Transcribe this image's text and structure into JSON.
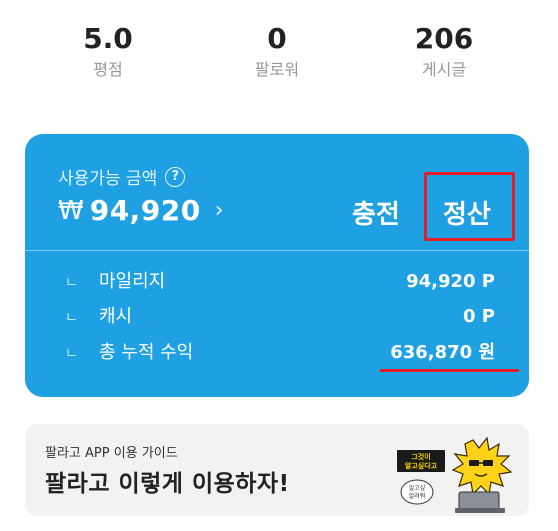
{
  "stats": [
    {
      "value": "5.0",
      "label": "평점"
    },
    {
      "value": "0",
      "label": "팔로워"
    },
    {
      "value": "206",
      "label": "게시글"
    }
  ],
  "wallet": {
    "available_label": "사용가능 금액",
    "help_icon": "question-circle-icon",
    "currency_symbol": "₩",
    "balance": "94,920",
    "chevron_icon": "chevron-right-icon",
    "charge_label": "충전",
    "settle_label": "정산",
    "rows": [
      {
        "bullet": "ㄴ",
        "name": "마일리지",
        "value": "94,920 P"
      },
      {
        "bullet": "ㄴ",
        "name": "캐시",
        "value": "0 P"
      },
      {
        "bullet": "ㄴ",
        "name": "총 누적 수익",
        "value": "636,870 원"
      }
    ],
    "card_color": "#1fa0e2",
    "highlight_color": "#e31b24"
  },
  "banner": {
    "subtitle": "팔라고 APP 이용 가이드",
    "title": "팔라고 이렇게 이용하자!",
    "mascot_caption": "그것이 알고싶다고",
    "mascot_bubble": "알고싶 알려줘"
  }
}
